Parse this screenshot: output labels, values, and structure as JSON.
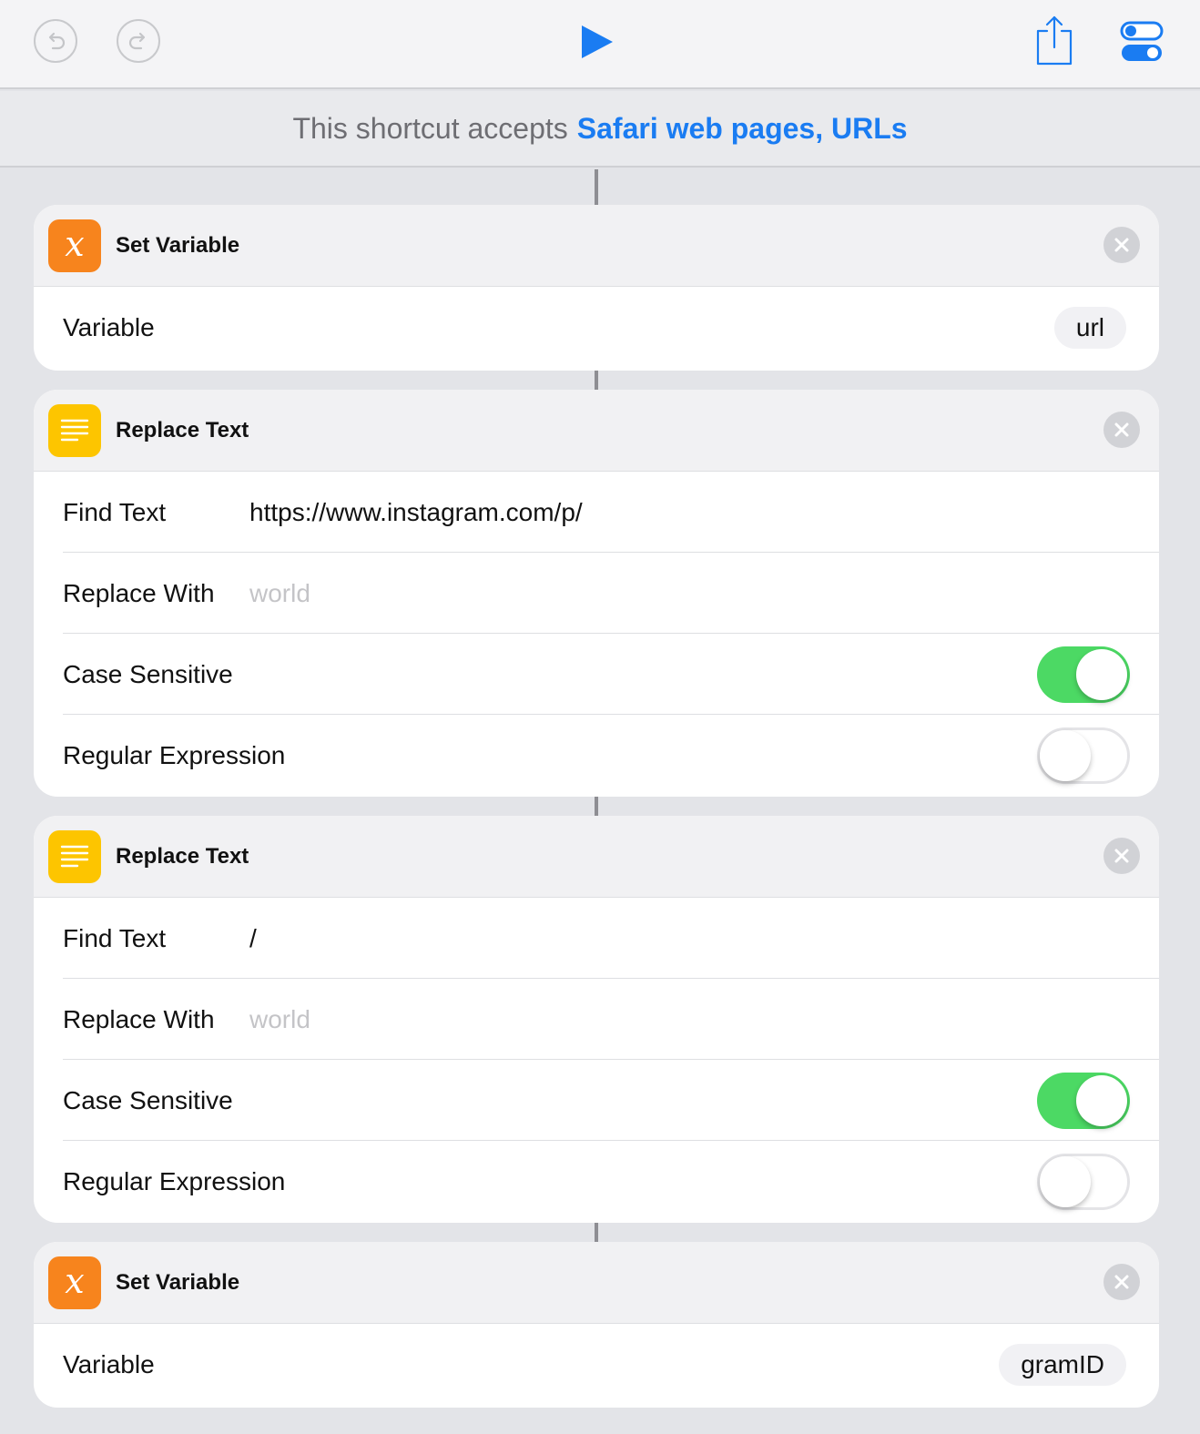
{
  "toolbar": {
    "undo_icon": "undo-icon",
    "redo_icon": "redo-icon",
    "play_icon": "play-icon",
    "share_icon": "share-icon",
    "settings_icon": "toggle-settings-icon",
    "accent_color": "#1a7cf2"
  },
  "accepts": {
    "prefix": "This shortcut accepts",
    "types": "Safari web pages, URLs"
  },
  "actions": [
    {
      "title": "Set Variable",
      "icon": "variable-icon",
      "icon_glyph": "x",
      "icon_color": "#f7841d",
      "variable_label": "Variable",
      "variable_value": "url"
    },
    {
      "title": "Replace Text",
      "icon": "text-icon",
      "icon_color": "#fdc500",
      "find_label": "Find Text",
      "find_value": "https://www.instagram.com/p/",
      "replace_label": "Replace With",
      "replace_placeholder": "world",
      "case_label": "Case Sensitive",
      "case_on": true,
      "regex_label": "Regular Expression",
      "regex_on": false
    },
    {
      "title": "Replace Text",
      "icon": "text-icon",
      "icon_color": "#fdc500",
      "find_label": "Find Text",
      "find_value": "/",
      "replace_label": "Replace With",
      "replace_placeholder": "world",
      "case_label": "Case Sensitive",
      "case_on": true,
      "regex_label": "Regular Expression",
      "regex_on": false
    },
    {
      "title": "Set Variable",
      "icon": "variable-icon",
      "icon_glyph": "x",
      "icon_color": "#f7841d",
      "variable_label": "Variable",
      "variable_value": "gramID"
    }
  ],
  "toggle_on_color": "#4cd964"
}
